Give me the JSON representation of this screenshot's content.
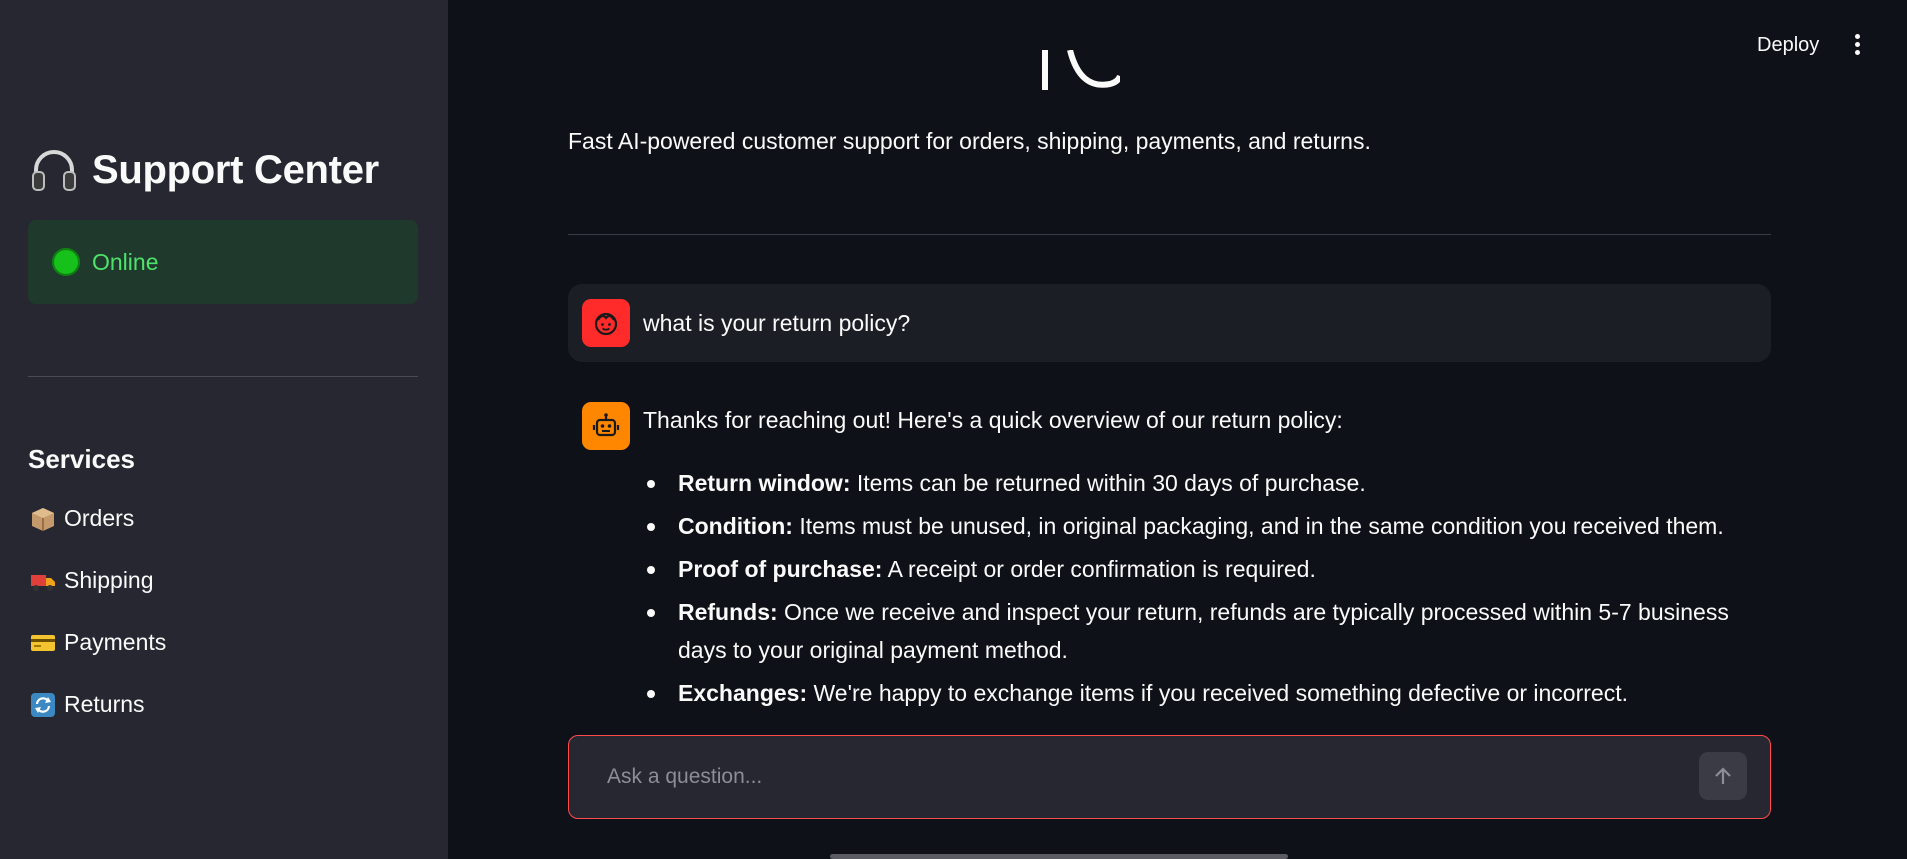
{
  "header": {
    "deploy_label": "Deploy",
    "menu_icon": "kebab-menu-icon"
  },
  "sidebar": {
    "title": "Support Center",
    "title_icon": "headphones-icon",
    "status": {
      "label": "Online",
      "color": "#17c11b"
    },
    "services_heading": "Services",
    "items": [
      {
        "label": "Orders",
        "icon": "package-icon"
      },
      {
        "label": "Shipping",
        "icon": "truck-icon"
      },
      {
        "label": "Payments",
        "icon": "credit-card-icon"
      },
      {
        "label": "Returns",
        "icon": "refresh-icon"
      }
    ]
  },
  "main": {
    "subtitle": "Fast AI-powered customer support for orders, shipping, payments, and returns.",
    "messages": {
      "user": {
        "text": "what is your return policy?",
        "avatar_color": "#ff2b2b"
      },
      "assistant": {
        "avatar_color": "#ff8700",
        "intro": "Thanks for reaching out! Here's a quick overview of our return policy:",
        "bullets": [
          {
            "term": "Return window:",
            "text": " Items can be returned within 30 days of purchase."
          },
          {
            "term": "Condition:",
            "text": " Items must be unused, in original packaging, and in the same condition you received them."
          },
          {
            "term": "Proof of purchase:",
            "text": " A receipt or order confirmation is required."
          },
          {
            "term": "Refunds:",
            "text": " Once we receive and inspect your return, refunds are typically processed within 5-7 business days to your original payment method."
          },
          {
            "term": "Exchanges:",
            "text": " We're happy to exchange items if you received something defective or incorrect."
          }
        ]
      }
    },
    "chat_input": {
      "placeholder": "Ask a question...",
      "value": ""
    }
  }
}
